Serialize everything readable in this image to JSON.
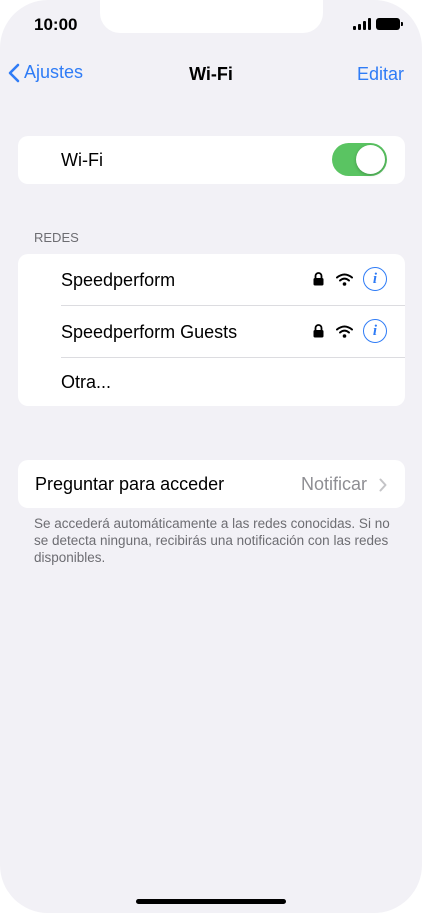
{
  "status": {
    "time": "10:00"
  },
  "nav": {
    "back_label": "Ajustes",
    "title": "Wi-Fi",
    "edit_label": "Editar"
  },
  "wifi_toggle": {
    "label": "Wi-Fi",
    "state": "on",
    "color": "#5ac462"
  },
  "networks": {
    "header": "REDES",
    "items": [
      {
        "name": "Speedperform",
        "locked": true,
        "icon": "wifi-icon"
      },
      {
        "name": "Speedperform Guests",
        "locked": true,
        "icon": "wifi-icon"
      }
    ],
    "other_label": "Otra..."
  },
  "ask_to_join": {
    "label": "Preguntar para acceder",
    "value": "Notificar",
    "footnote": "Se accederá automáticamente a las redes conocidas. Si no se detecta ninguna, recibirás una notificación con las redes disponibles."
  },
  "colors": {
    "accent": "#2f7cf6",
    "background": "#f2f1f6"
  }
}
